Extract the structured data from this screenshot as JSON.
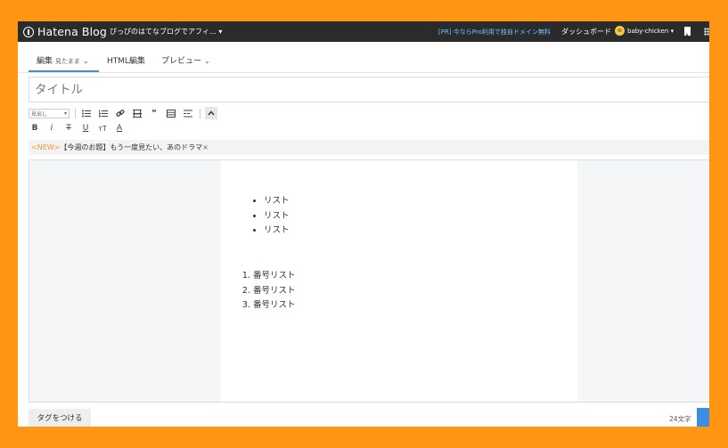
{
  "header": {
    "logo_text": "Hatena Blog",
    "blog_name": "ぴっぴのはてなブログでアフィ… ▾",
    "promo": "[PR] 今ならPro利用で独自ドメイン無料",
    "dashboard": "ダッシュボード",
    "user": "baby-chicken ▾"
  },
  "tabs": {
    "edit": {
      "label": "編集",
      "sub": "見たまま"
    },
    "html": {
      "label": "HTML編集"
    },
    "preview": {
      "label": "プレビュー"
    }
  },
  "title_placeholder": "タイトル",
  "toolbar": {
    "heading_placeholder": "見出し",
    "icons": [
      "bullet-list-icon",
      "numbered-list-icon",
      "link-icon",
      "horizontal-rule-icon",
      "quote-icon",
      "table-icon",
      "more-icon",
      "collapse-icon",
      "bold-icon",
      "italic-icon",
      "strikethrough-icon",
      "underline-icon",
      "font-size-icon",
      "text-color-icon"
    ]
  },
  "news": {
    "new": "<NEW>",
    "text": "【今週のお題】もう一度見たい、あのドラマ",
    "close": "×"
  },
  "editor": {
    "bullets": [
      "リスト",
      "リスト",
      "リスト"
    ],
    "numbered": [
      "番号リスト",
      "番号リスト",
      "番号リスト"
    ]
  },
  "footer": {
    "tag_button": "タグをつける",
    "char_count": "24文字"
  },
  "colors": {
    "background": "#ff9512",
    "topbar": "#2b2b2b",
    "accent": "#3b8ee0",
    "new_label": "#f19b2c"
  }
}
